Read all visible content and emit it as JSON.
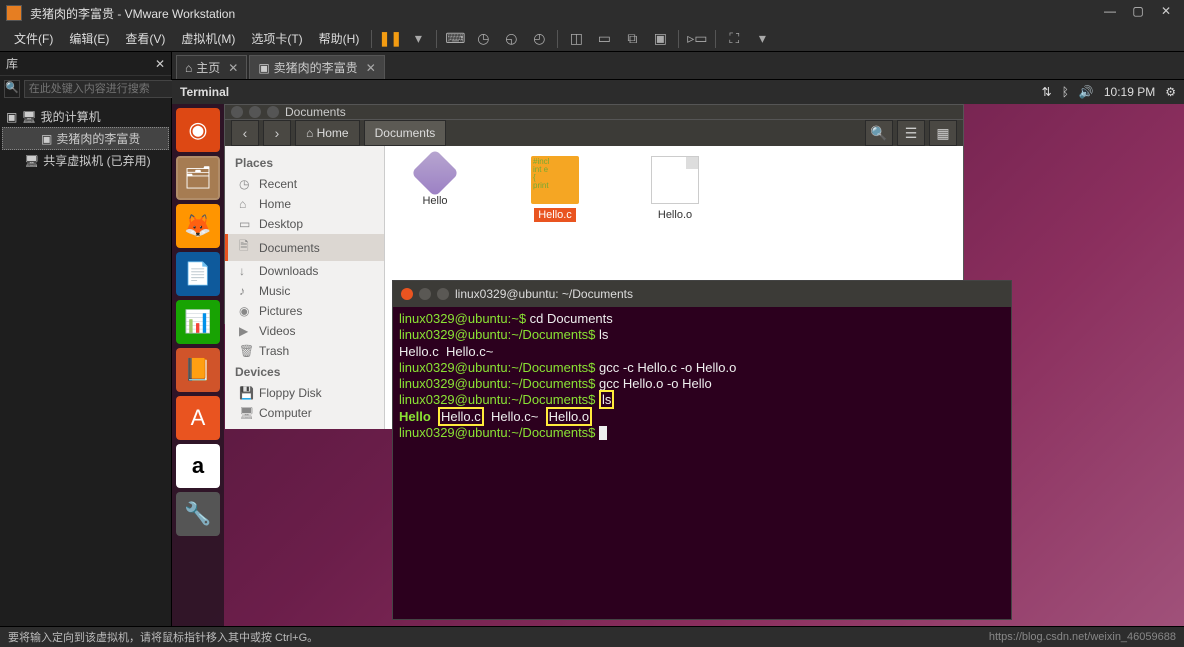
{
  "vmware": {
    "title": "卖猪肉的李富贵 - VMware Workstation",
    "menu": [
      "文件(F)",
      "编辑(E)",
      "查看(V)",
      "虚拟机(M)",
      "选项卡(T)",
      "帮助(H)"
    ],
    "library": {
      "title": "库",
      "search_placeholder": "在此处键入内容进行搜索",
      "root": "我的计算机",
      "vm_active": "卖猪肉的李富贵",
      "vm_disabled": "共享虚拟机 (已弃用)"
    },
    "tabs": {
      "home": "主页",
      "vm": "卖猪肉的李富贵"
    },
    "status": "要将输入定向到该虚拟机，请将鼠标指针移入其中或按 Ctrl+G。",
    "watermark": "https://blog.csdn.net/weixin_46059688"
  },
  "ubuntu": {
    "panel": {
      "app": "Terminal",
      "time": "10:19 PM"
    },
    "nautilus": {
      "title": "Documents",
      "crumb_home": "Home",
      "crumb_docs": "Documents",
      "places_header": "Places",
      "places": [
        "Recent",
        "Home",
        "Desktop",
        "Documents",
        "Downloads",
        "Music",
        "Pictures",
        "Videos",
        "Trash"
      ],
      "devices_header": "Devices",
      "devices": [
        "Floppy Disk",
        "Computer"
      ],
      "files": [
        {
          "name": "Hello",
          "type": "exec"
        },
        {
          "name": "Hello.c",
          "type": "cfile",
          "selected": true
        },
        {
          "name": "Hello.o",
          "type": "ofile"
        }
      ]
    },
    "terminal": {
      "title": "linux0329@ubuntu: ~/Documents",
      "lines": {
        "l1_prompt": "linux0329@ubuntu:~$",
        "l1_cmd": " cd Documents",
        "l2_prompt": "linux0329@ubuntu:~/Documents$",
        "l2_cmd": " ls",
        "l3": "Hello.c  Hello.c~",
        "l4_prompt": "linux0329@ubuntu:~/Documents$",
        "l4_cmd": " gcc -c Hello.c -o Hello.o",
        "l5_prompt": "linux0329@ubuntu:~/Documents$",
        "l5_cmd": " gcc Hello.o -o Hello",
        "l6_prompt": "linux0329@ubuntu:~/Documents$",
        "l6_cmd_ls": "ls",
        "l7_hello": "Hello",
        "l7_helloc": "Hello.c",
        "l7_helloct": "Hello.c~",
        "l7_helloo": "Hello.o",
        "l8_prompt": "linux0329@ubuntu:~/Documents$"
      }
    }
  }
}
